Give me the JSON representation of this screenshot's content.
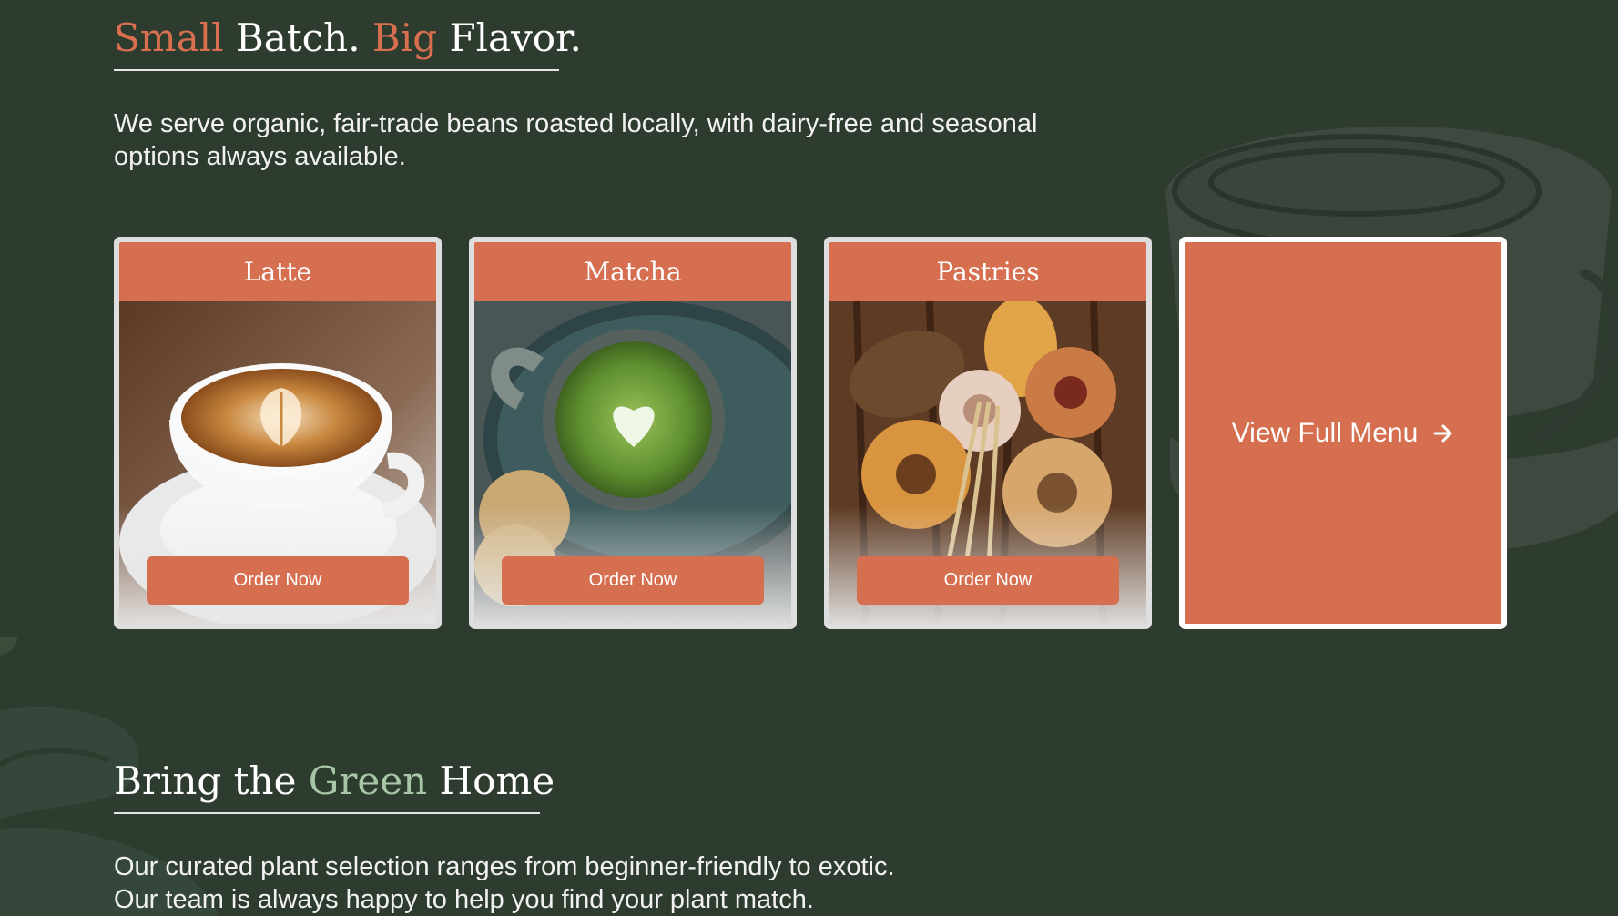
{
  "menu_section": {
    "title_parts": [
      "Small",
      " Batch. ",
      "Big",
      " Flavor."
    ],
    "description": "We serve organic, fair-trade beans roasted locally, with dairy-free and seasonal options always available."
  },
  "cards": [
    {
      "title": "Latte",
      "button_label": "Order Now"
    },
    {
      "title": "Matcha",
      "button_label": "Order Now"
    },
    {
      "title": "Pastries",
      "button_label": "Order Now"
    }
  ],
  "full_menu": {
    "label": "View Full Menu",
    "icon": "arrow-right-icon"
  },
  "plants_section": {
    "title_parts": [
      "Bring the ",
      "Green",
      " Home"
    ],
    "description_lines": [
      "Our curated plant selection ranges from beginner-friendly to exotic.",
      "Our team is always happy to help you find your plant match."
    ]
  },
  "colors": {
    "background": "#2e3b2f",
    "accent_orange": "#d66f50",
    "accent_green": "#a6c6a5",
    "card_border": "#dedede"
  }
}
